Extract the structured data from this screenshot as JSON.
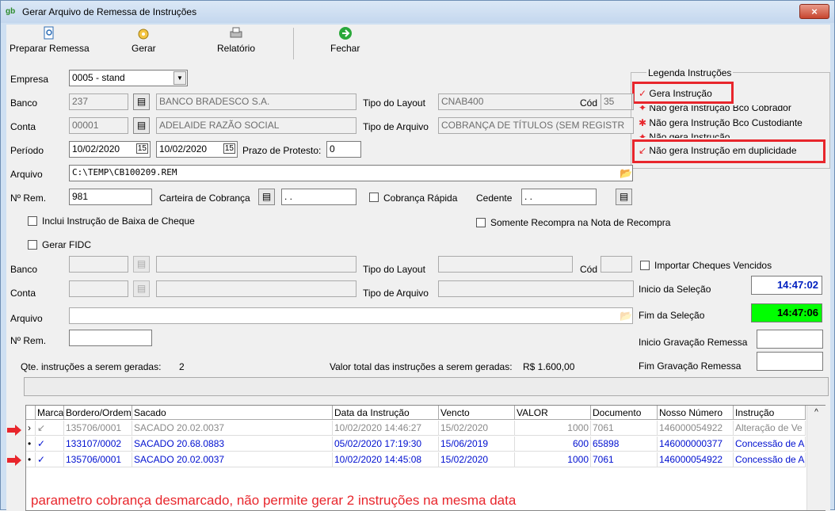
{
  "window": {
    "title": "Gerar Arquivo de Remessa de Instruções",
    "app_icon": "gb",
    "close": "×"
  },
  "toolbar": {
    "preparar": "Preparar Remessa",
    "gerar": "Gerar",
    "relatorio": "Relatório",
    "fechar": "Fechar"
  },
  "form": {
    "empresa_label": "Empresa",
    "empresa_value": "0005 - stand",
    "banco_label": "Banco",
    "banco_code": "237",
    "banco_name": "BANCO BRADESCO S.A.",
    "tipo_layout_label": "Tipo do Layout",
    "tipo_layout_value": "CNAB400",
    "cod_label": "Cód",
    "cod_value": "35",
    "conta_label": "Conta",
    "conta_code": "00001",
    "conta_name": "ADELAIDE RAZÃO SOCIAL",
    "tipo_arquivo_label": "Tipo de Arquivo",
    "tipo_arquivo_value": "COBRANÇA DE TÍTULOS (SEM REGISTR",
    "periodo_label": "Período",
    "periodo_de": "10/02/2020",
    "periodo_ate": "10/02/2020",
    "prazo_label": "Prazo de Protesto:",
    "prazo_value": "0",
    "arquivo_label": "Arquivo",
    "arquivo_value": "C:\\TEMP\\CB100209.REM",
    "nrem_label": "Nº Rem.",
    "nrem_value": "981",
    "carteira_label": "Carteira de Cobrança",
    "carteira_value": "  .  .",
    "cobranca_rapida": "Cobrança Rápida",
    "cedente_label": "Cedente",
    "cedente_value": "  .  .",
    "inclui_baixa": "Inclui Instrução de Baixa de Cheque",
    "somente_recompra": "Somente Recompra na Nota de Recompra",
    "gerar_fidc": "Gerar FIDC",
    "banco2_label": "Banco",
    "tipo_layout2_label": "Tipo do Layout",
    "cod2_label": "Cód",
    "importar_cheques": "Importar Cheques Vencidos",
    "conta2_label": "Conta",
    "tipo_arquivo2_label": "Tipo de Arquivo",
    "arquivo2_label": "Arquivo",
    "nrem2_label": "Nº Rem.",
    "inicio_selecao_label": "Inicio da Seleção",
    "inicio_selecao": "14:47:02",
    "fim_selecao_label": "Fim da Seleção",
    "fim_selecao": "14:47:06",
    "inicio_gravacao_label": "Inicio Gravação Remessa",
    "fim_gravacao_label": "Fim Gravação Remessa",
    "qte_label": "Qte. instruções a serem geradas:",
    "qte_value": "2",
    "valor_label": "Valor total das instruções a serem geradas:",
    "valor_value": "R$ 1.600,00"
  },
  "legend": {
    "title": "Legenda Instruções",
    "items": [
      {
        "icon": "✓",
        "label": "Gera Instrução"
      },
      {
        "icon": "✦",
        "label": "Não gera Instrução Bco Cobrador"
      },
      {
        "icon": "✱",
        "label": "Não gera Instrução Bco Custodiante"
      },
      {
        "icon": "✦",
        "label": "Não gera Instrução"
      },
      {
        "icon": "↙",
        "label": "Não gera Instrução em duplicidade"
      }
    ]
  },
  "grid": {
    "headers": [
      "Marca",
      "Bordero/Ordem",
      "Sacado",
      "Data da Instrução",
      "Vencto",
      "VALOR",
      "Documento",
      "Nosso Número",
      "Instrução"
    ],
    "rows": [
      [
        "↙",
        "135706/0001",
        "SACADO 20.02.0037",
        "10/02/2020 14:46:27",
        "15/02/2020",
        "1000",
        "7061",
        "146000054922",
        "Alteração de Ve"
      ],
      [
        "✓",
        "133107/0002",
        "SACADO 20.68.0883",
        "05/02/2020 17:19:30",
        "15/06/2019",
        "600",
        "65898",
        "146000000377",
        "Concessão de A"
      ],
      [
        "✓",
        "135706/0001",
        "SACADO 20.02.0037",
        "10/02/2020 14:45:08",
        "15/02/2020",
        "1000",
        "7061",
        "146000054922",
        "Concessão de A"
      ]
    ]
  },
  "annotation": "parametro cobrança desmarcado, não permite gerar 2 instruções na mesma data",
  "colors": {
    "accent_red": "#e8262c",
    "time_blue": "#0020c0",
    "time_green": "#00ff00"
  }
}
